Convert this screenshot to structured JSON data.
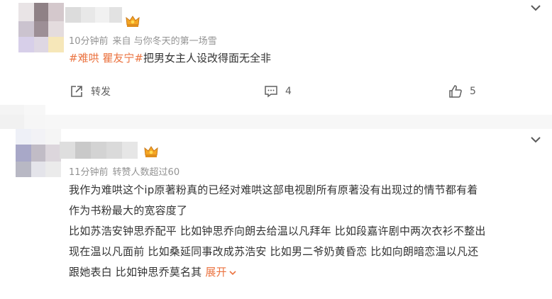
{
  "post1": {
    "meta_time": "10分钟前",
    "meta_from": "来自 与你冬天的第一场雪",
    "tag1": "#难哄",
    "tag2": "瞿友宁#",
    "content_text": "把男女主人设改得面无全非",
    "repost_label": "转发",
    "comment_count": "4",
    "like_count": "5",
    "icons": {
      "repost": "repost-icon",
      "comment": "comment-icon",
      "like": "like-icon",
      "more": "chevron-down-icon",
      "badge": "crown-icon"
    }
  },
  "post2": {
    "meta_time": "11分钟前",
    "meta_extra": "转赞人数超过60",
    "line1": "我作为难哄这个ip原著粉真的已经对难哄这部电视剧所有原著没有出现过的情节都有着",
    "line2": "作为书粉最大的宽容度了",
    "line3": "比如苏浩安钟思乔配平 比如钟思乔向朗去给温以凡拜年 比如段嘉许剧中两次衣衫不整出",
    "line4": "现在温以凡面前 比如桑延同事改成苏浩安 比如男二爷奶黄昏恋 比如向朗暗恋温以凡还",
    "line5": "跟她表白 比如钟思乔莫名其",
    "expand_label": "展开"
  },
  "colors": {
    "accent": "#eb7340",
    "meta": "#939393",
    "text": "#333333",
    "action": "#606060"
  }
}
